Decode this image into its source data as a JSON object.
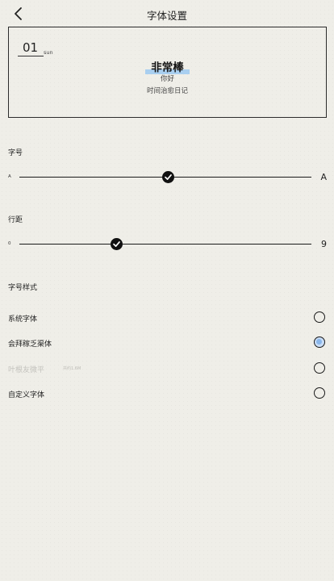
{
  "header": {
    "title": "字体设置",
    "back_icon": "chevron-left-icon"
  },
  "preview": {
    "date_number": "01",
    "date_day": "sun",
    "title": "非常棒",
    "subtitle": "你好",
    "line": "时间治愈日记"
  },
  "font_size": {
    "label": "字号",
    "min_label": "A",
    "max_label": "A",
    "value_fraction": 0.51
  },
  "line_spacing": {
    "label": "行距",
    "min_label": "0",
    "max_label": "9",
    "value": 3
  },
  "font_style": {
    "label": "字号样式",
    "options": [
      {
        "label": "系统字体",
        "extra": "",
        "selected": false,
        "disabled": false
      },
      {
        "label": "会拜稼乏渠体",
        "extra": "",
        "selected": true,
        "disabled": false
      },
      {
        "label": "叶根友微平",
        "extra": "共约1.6M",
        "selected": false,
        "disabled": true
      },
      {
        "label": "自定义字体",
        "extra": "",
        "selected": false,
        "disabled": false
      }
    ]
  },
  "colors": {
    "accent": "#8ab6ea",
    "highlight": "#a9cff0",
    "background": "#efeee8",
    "thumb": "#111111"
  }
}
